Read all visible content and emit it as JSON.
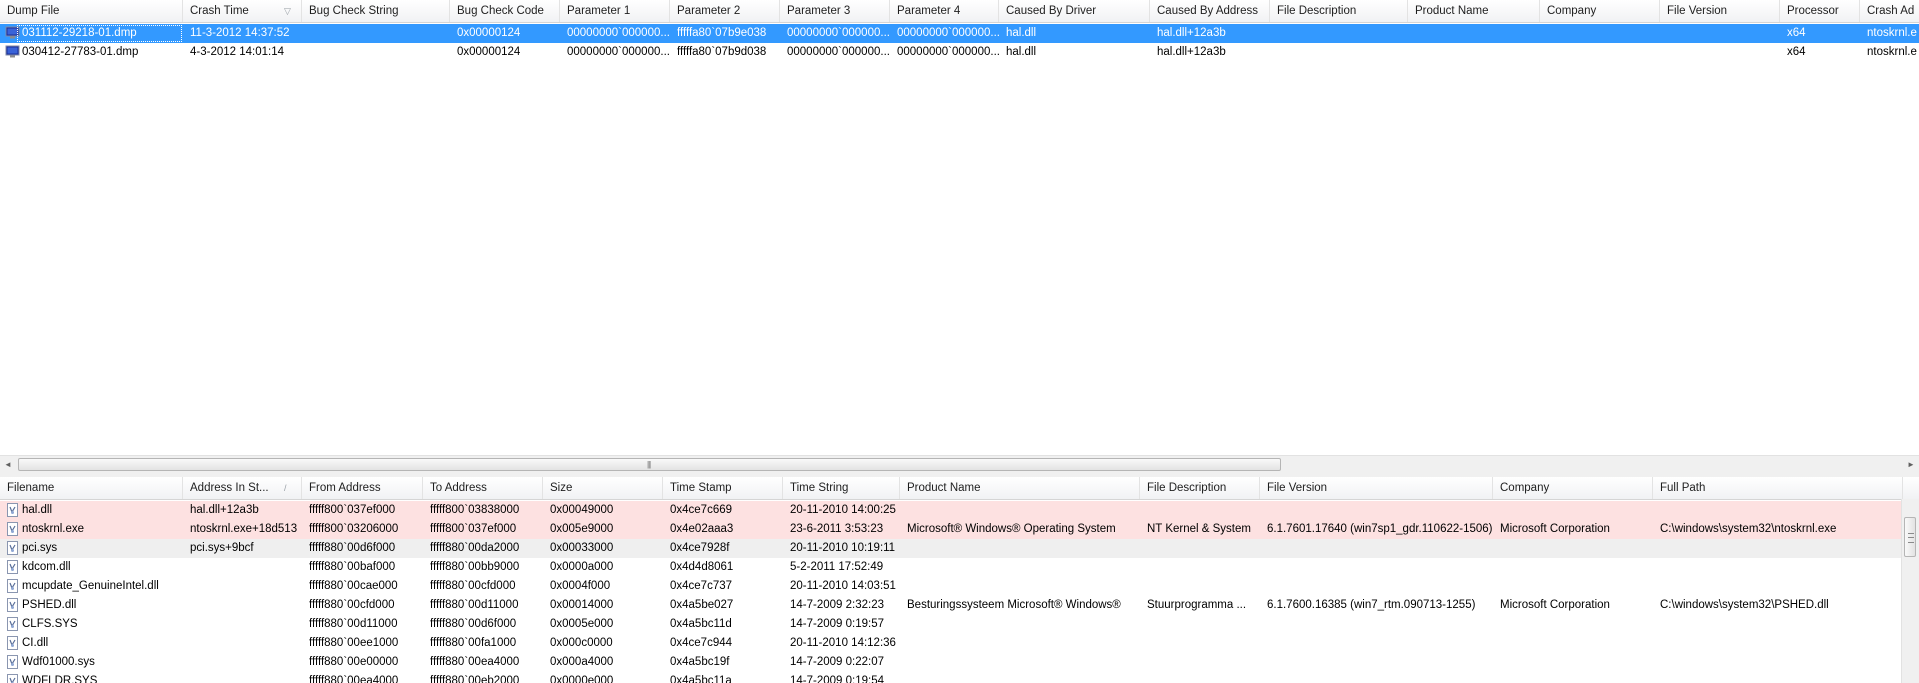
{
  "colors": {
    "selection": "#3399ff",
    "highlight_pink": "#fde1e1",
    "highlight_grey": "#efefef"
  },
  "dump_list": {
    "columns": [
      "Dump File",
      "Crash Time",
      "Bug Check String",
      "Bug Check Code",
      "Parameter 1",
      "Parameter 2",
      "Parameter 3",
      "Parameter 4",
      "Caused By Driver",
      "Caused By Address",
      "File Description",
      "Product Name",
      "Company",
      "File Version",
      "Processor",
      "Crash Ad"
    ],
    "sorted_column_index": 1,
    "sort_glyph": "▽",
    "rows": [
      {
        "icon": "monitor-icon",
        "selected": true,
        "cells": [
          "031112-29218-01.dmp",
          "11-3-2012 14:37:52",
          "",
          "0x00000124",
          "00000000`000000...",
          "fffffa80`07b9e038",
          "00000000`000000...",
          "00000000`000000...",
          "hal.dll",
          "hal.dll+12a3b",
          "",
          "",
          "",
          "",
          "x64",
          "ntoskrnl.e"
        ]
      },
      {
        "icon": "monitor-icon",
        "selected": false,
        "cells": [
          "030412-27783-01.dmp",
          "4-3-2012 14:01:14",
          "",
          "0x00000124",
          "00000000`000000...",
          "fffffa80`07b9d038",
          "00000000`000000...",
          "00000000`000000...",
          "hal.dll",
          "hal.dll+12a3b",
          "",
          "",
          "",
          "",
          "x64",
          "ntoskrnl.e"
        ]
      }
    ]
  },
  "hscrollbar": {
    "left_arrow": "◄",
    "right_arrow": "►",
    "grip": "|||"
  },
  "driver_list": {
    "columns": [
      "Filename",
      "Address In St...",
      "From Address",
      "To Address",
      "Size",
      "Time Stamp",
      "Time String",
      "Product Name",
      "File Description",
      "File Version",
      "Company",
      "Full Path"
    ],
    "sorted_column_index": 1,
    "sort_glyph": "/",
    "rows": [
      {
        "icon": "file-icon",
        "highlight": "pink",
        "cells": [
          "hal.dll",
          "hal.dll+12a3b",
          "fffff800`037ef000",
          "fffff800`03838000",
          "0x00049000",
          "0x4ce7c669",
          "20-11-2010 14:00:25",
          "",
          "",
          "",
          "",
          ""
        ]
      },
      {
        "icon": "file-icon",
        "highlight": "pink",
        "cells": [
          "ntoskrnl.exe",
          "ntoskrnl.exe+18d513",
          "fffff800`03206000",
          "fffff800`037ef000",
          "0x005e9000",
          "0x4e02aaa3",
          "23-6-2011 3:53:23",
          "Microsoft® Windows® Operating System",
          "NT Kernel & System",
          "6.1.7601.17640 (win7sp1_gdr.110622-1506)",
          "Microsoft Corporation",
          "C:\\windows\\system32\\ntoskrnl.exe"
        ]
      },
      {
        "icon": "file-icon",
        "highlight": "grey",
        "cells": [
          "pci.sys",
          "pci.sys+9bcf",
          "fffff880`00d6f000",
          "fffff880`00da2000",
          "0x00033000",
          "0x4ce7928f",
          "20-11-2010 10:19:11",
          "",
          "",
          "",
          "",
          ""
        ]
      },
      {
        "icon": "file-icon",
        "highlight": "none",
        "cells": [
          "kdcom.dll",
          "",
          "fffff880`00baf000",
          "fffff880`00bb9000",
          "0x0000a000",
          "0x4d4d8061",
          "5-2-2011 17:52:49",
          "",
          "",
          "",
          "",
          ""
        ]
      },
      {
        "icon": "file-icon",
        "highlight": "none",
        "cells": [
          "mcupdate_GenuineIntel.dll",
          "",
          "fffff880`00cae000",
          "fffff880`00cfd000",
          "0x0004f000",
          "0x4ce7c737",
          "20-11-2010 14:03:51",
          "",
          "",
          "",
          "",
          ""
        ]
      },
      {
        "icon": "file-icon",
        "highlight": "none",
        "cells": [
          "PSHED.dll",
          "",
          "fffff880`00cfd000",
          "fffff880`00d11000",
          "0x00014000",
          "0x4a5be027",
          "14-7-2009 2:32:23",
          "Besturingssysteem Microsoft® Windows®",
          "Stuurprogramma ...",
          "6.1.7600.16385 (win7_rtm.090713-1255)",
          "Microsoft Corporation",
          "C:\\windows\\system32\\PSHED.dll"
        ]
      },
      {
        "icon": "file-icon",
        "highlight": "none",
        "cells": [
          "CLFS.SYS",
          "",
          "fffff880`00d11000",
          "fffff880`00d6f000",
          "0x0005e000",
          "0x4a5bc11d",
          "14-7-2009 0:19:57",
          "",
          "",
          "",
          "",
          ""
        ]
      },
      {
        "icon": "file-icon",
        "highlight": "none",
        "cells": [
          "CI.dll",
          "",
          "fffff880`00ee1000",
          "fffff880`00fa1000",
          "0x000c0000",
          "0x4ce7c944",
          "20-11-2010 14:12:36",
          "",
          "",
          "",
          "",
          ""
        ]
      },
      {
        "icon": "file-icon",
        "highlight": "none",
        "cells": [
          "Wdf01000.sys",
          "",
          "fffff880`00e00000",
          "fffff880`00ea4000",
          "0x000a4000",
          "0x4a5bc19f",
          "14-7-2009 0:22:07",
          "",
          "",
          "",
          "",
          ""
        ]
      },
      {
        "icon": "file-icon",
        "highlight": "none",
        "cells": [
          "WDFLDR.SYS",
          "",
          "fffff880`00ea4000",
          "fffff880`00eb2000",
          "0x0000e000",
          "0x4a5bc11a",
          "14-7-2009 0:19:54",
          "",
          "",
          "",
          "",
          ""
        ]
      }
    ]
  }
}
